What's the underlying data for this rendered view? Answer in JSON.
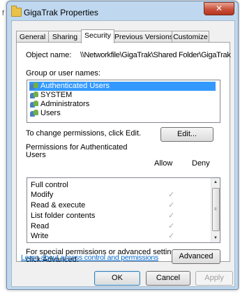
{
  "window": {
    "title": "GigaTrak Properties",
    "close_glyph": "✕",
    "edge_mark": "f"
  },
  "tabs": [
    {
      "label": "General",
      "active": false
    },
    {
      "label": "Sharing",
      "active": false
    },
    {
      "label": "Security",
      "active": true
    },
    {
      "label": "Previous Versions",
      "active": false
    },
    {
      "label": "Customize",
      "active": false
    }
  ],
  "security": {
    "object_name_label": "Object name:",
    "object_name_value": "\\\\Networkfile\\GigaTrak\\Shared Folder\\GigaTrak",
    "group_label": "Group or user names:",
    "groups": [
      {
        "name": "Authenticated Users",
        "selected": true
      },
      {
        "name": "SYSTEM",
        "selected": false
      },
      {
        "name": "Administrators",
        "selected": false
      },
      {
        "name": "Users",
        "selected": false
      }
    ],
    "change_text": "To change permissions, click Edit.",
    "edit_button": "Edit...",
    "permissions_for_line1": "Permissions for Authenticated",
    "permissions_for_line2": "Users",
    "allow_header": "Allow",
    "deny_header": "Deny",
    "permissions": [
      {
        "name": "Full control",
        "allow": false,
        "deny": false
      },
      {
        "name": "Modify",
        "allow": true,
        "deny": false
      },
      {
        "name": "Read & execute",
        "allow": true,
        "deny": false
      },
      {
        "name": "List folder contents",
        "allow": true,
        "deny": false
      },
      {
        "name": "Read",
        "allow": true,
        "deny": false
      },
      {
        "name": "Write",
        "allow": true,
        "deny": false
      }
    ],
    "check_glyph": "✓",
    "scroll_up_glyph": "▲",
    "scroll_down_glyph": "▼",
    "scroll_grip_glyph": "≡",
    "special_text_line1": "For special permissions or advanced settings,",
    "special_text_line2": "click Advanced.",
    "advanced_button": "Advanced",
    "learn_link": "Learn about access control and permissions"
  },
  "footer": {
    "ok": "OK",
    "cancel": "Cancel",
    "apply": "Apply"
  }
}
